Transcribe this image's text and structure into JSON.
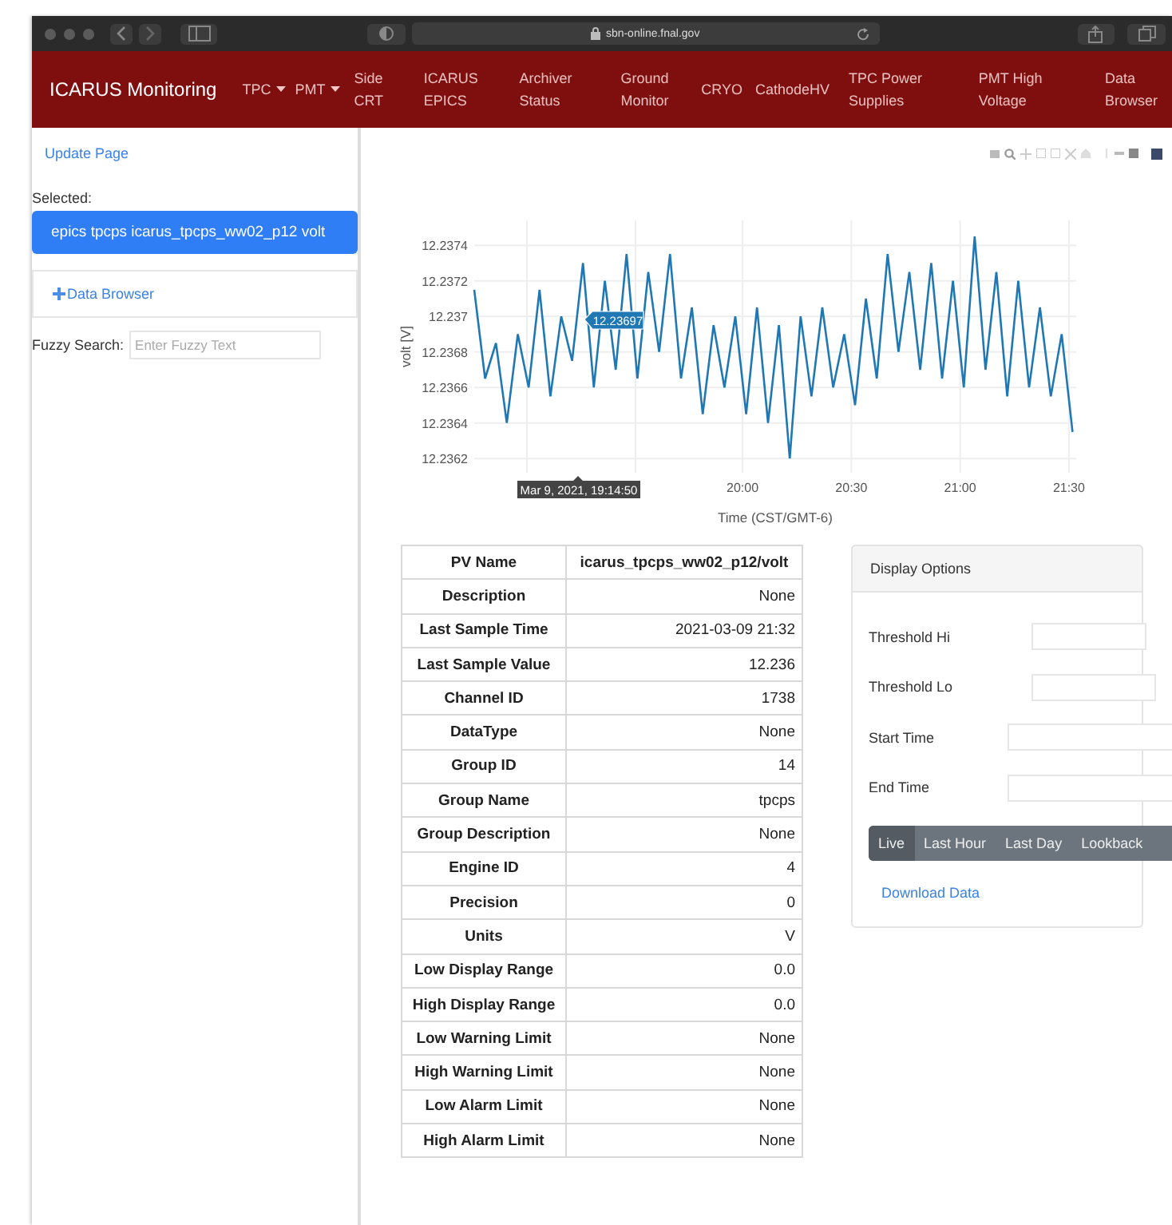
{
  "browser": {
    "url": "sbn-online.fnal.gov"
  },
  "navbar": {
    "brand": "ICARUS Monitoring",
    "items": [
      {
        "label": "TPC",
        "dropdown": true
      },
      {
        "label": "PMT",
        "dropdown": true
      },
      {
        "label": "Side CRT",
        "dropdown": false
      },
      {
        "label": "ICARUS EPICS",
        "dropdown": false
      },
      {
        "label": "Archiver Status",
        "dropdown": false
      },
      {
        "label": "Ground Monitor",
        "dropdown": false
      },
      {
        "label": "CRYO",
        "dropdown": false
      },
      {
        "label": "CathodeHV",
        "dropdown": false
      },
      {
        "label": "TPC Power Supplies",
        "dropdown": false
      },
      {
        "label": "PMT High Voltage",
        "dropdown": false
      },
      {
        "label": "Data Browser",
        "dropdown": false
      }
    ]
  },
  "sidebar": {
    "update_link": "Update Page",
    "selected_label": "Selected:",
    "selected_item": "epics tpcps icarus_tpcps_ww02_p12 volt",
    "data_browser": "Data Browser",
    "search_label": "Fuzzy Search:",
    "search": {
      "placeholder": "Enter Fuzzy Text"
    }
  },
  "plot": {
    "hover_value": "12.23697",
    "hover_time": "Mar 9, 2021, 19:14:50",
    "chart_data": {
      "type": "line",
      "xlabel": "Time (CST/GMT-6)",
      "ylabel": "volt [V]",
      "x": [
        1126,
        1129,
        1132,
        1135,
        1138,
        1141,
        1144,
        1147,
        1150,
        1153,
        1156,
        1159,
        1162,
        1165,
        1168,
        1171,
        1174,
        1177,
        1180,
        1183,
        1186,
        1189,
        1192,
        1195,
        1198,
        1201,
        1204,
        1207,
        1210,
        1213,
        1216,
        1219,
        1222,
        1225,
        1228,
        1231,
        1234,
        1237,
        1240,
        1243,
        1246,
        1249,
        1252,
        1255,
        1258,
        1261,
        1264,
        1267,
        1270,
        1273,
        1276,
        1279,
        1282,
        1285,
        1288,
        1291
      ],
      "grid": true,
      "series": [
        {
          "color": "#1f77b4",
          "values": [
            12.23715,
            12.23665,
            12.23685,
            12.2364,
            12.2369,
            12.2366,
            12.23715,
            12.23655,
            12.237,
            12.23675,
            12.2373,
            12.2366,
            12.2372,
            12.2367,
            12.23735,
            12.23665,
            12.23725,
            12.2368,
            12.23735,
            12.23665,
            12.23705,
            12.23645,
            12.23695,
            12.2366,
            12.237,
            12.23645,
            12.23705,
            12.2364,
            12.23695,
            12.2362,
            12.237,
            12.23655,
            12.23705,
            12.2366,
            12.2369,
            12.2365,
            12.2371,
            12.23665,
            12.23735,
            12.2368,
            12.23725,
            12.2367,
            12.2373,
            12.23665,
            12.2372,
            12.2366,
            12.23745,
            12.2367,
            12.23725,
            12.23655,
            12.2372,
            12.2366,
            12.23705,
            12.23655,
            12.2369,
            12.23635
          ]
        }
      ],
      "xlim": [
        1126,
        1292
      ],
      "ylim": [
        12.23612,
        12.23754
      ],
      "xticks": [
        {
          "value": 1200,
          "label": "20:00"
        },
        {
          "value": 1230,
          "label": "20:30"
        },
        {
          "value": 1260,
          "label": "21:00"
        },
        {
          "value": 1290,
          "label": "21:30"
        }
      ],
      "yticks": [
        {
          "value": 12.2362,
          "label": "12.2362"
        },
        {
          "value": 12.2364,
          "label": "12.2364"
        },
        {
          "value": 12.2366,
          "label": "12.2366"
        },
        {
          "value": 12.2368,
          "label": "12.2368"
        },
        {
          "value": 12.237,
          "label": "12.237"
        },
        {
          "value": 12.2372,
          "label": "12.2372"
        },
        {
          "value": 12.2374,
          "label": "12.2374"
        }
      ]
    }
  },
  "table": {
    "rows": [
      {
        "label": "PV Name",
        "value": "icarus_tpcps_ww02_p12/volt",
        "kind": "header"
      },
      {
        "label": "Description",
        "value": "None",
        "kind": "row"
      },
      {
        "label": "Last Sample Time",
        "value": "2021-03-09 21:32",
        "kind": "row"
      },
      {
        "label": "Last Sample Value",
        "value": "12.236",
        "kind": "row"
      },
      {
        "label": "Channel ID",
        "value": "1738",
        "kind": "row"
      },
      {
        "label": "DataType",
        "value": "None",
        "kind": "row"
      },
      {
        "label": "Group ID",
        "value": "14",
        "kind": "row"
      },
      {
        "label": "Group Name",
        "value": "tpcps",
        "kind": "row"
      },
      {
        "label": "Group Description",
        "value": "None",
        "kind": "row"
      },
      {
        "label": "Engine ID",
        "value": "4",
        "kind": "row"
      },
      {
        "label": "Precision",
        "value": "0",
        "kind": "row"
      },
      {
        "label": "Units",
        "value": "V",
        "kind": "row"
      },
      {
        "label": "Low Display Range",
        "value": "0.0",
        "kind": "row"
      },
      {
        "label": "High Display Range",
        "value": "0.0",
        "kind": "row"
      },
      {
        "label": "Low Warning Limit",
        "value": "None",
        "kind": "row"
      },
      {
        "label": "High Warning Limit",
        "value": "None",
        "kind": "row"
      },
      {
        "label": "Low Alarm Limit",
        "value": "None",
        "kind": "row"
      },
      {
        "label": "High Alarm Limit",
        "value": "None",
        "kind": "row"
      }
    ]
  },
  "display_options": {
    "title": "Display Options",
    "fields": [
      {
        "label": "Threshold Hi",
        "kind": "short"
      },
      {
        "label": "Threshold Lo",
        "kind": "medium"
      },
      {
        "label": "Start Time",
        "kind": "long"
      },
      {
        "label": "End Time",
        "kind": "long"
      }
    ],
    "ranges": [
      {
        "label": "Live",
        "selected": true
      },
      {
        "label": "Last Hour",
        "selected": false
      },
      {
        "label": "Last Day",
        "selected": false
      },
      {
        "label": "Lookback",
        "selected": false
      }
    ],
    "download": "Download Data"
  }
}
